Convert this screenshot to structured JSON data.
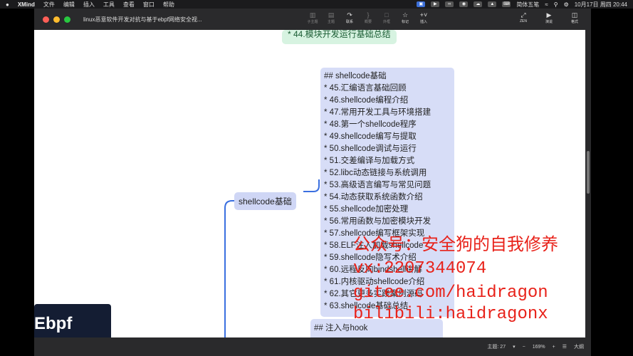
{
  "menubar": {
    "app_name": "XMind",
    "menus": [
      "文件",
      "编辑",
      "插入",
      "工具",
      "查看",
      "窗口",
      "帮助"
    ],
    "input_method": "简体五笔",
    "datetime": "10月17日 周四 20:44"
  },
  "window": {
    "title": "linux恶意软件开发对抗与基于ebpf网络安全视...",
    "toolbar": {
      "items": [
        "子主题",
        "主题",
        "联系",
        "概要",
        "外框",
        "标记",
        "插入"
      ],
      "zen_label": "ZEN",
      "present_label": "演说",
      "format_label": "格式"
    }
  },
  "mindmap": {
    "top_node": "* 44.模块开发运行基础总结",
    "root_label": "shellcode基础",
    "main_lines": [
      "## shellcode基础",
      "* 45.汇编语言基础回顾",
      "* 46.shellcode编程介绍",
      "* 47.常用开发工具与环境搭建",
      "* 48.第一个shellcode程序",
      "* 49.shellcode编写与提取",
      "* 50.shellcode调试与运行",
      "* 51.交差编译与加载方式",
      "* 52.libc动态链接与系统调用",
      "* 53.高级语言编写与常见问题",
      "* 54.动态获取系统函数介绍",
      "* 55.shellcode加密处理",
      "* 56.常用函数与加密模块开发",
      "* 57.shellcode编写框架实现",
      "* 58.ELF注入加载shellcode",
      "* 59.shellcode隐写术介绍",
      "* 60.远程反向bindshell讲解",
      "* 61.内核驱动shellcode介绍",
      "* 62.其它更多实践案例源码",
      "* 63.shellcode基础总结"
    ],
    "next_node": "## 注入与hook",
    "left_node": "Ebpf"
  },
  "watermark": {
    "line1": "公众号：安全狗的自我修养",
    "line2": "vx:2207344074",
    "line3": "gitee.com/haidragon",
    "line4": "bilibili:haidragonx"
  },
  "status": {
    "topics": "主题: 27",
    "zoom": "169%",
    "outline": "大纲"
  },
  "colors": {
    "connector": "#3a6fe0",
    "watermark": "#e8221a"
  }
}
